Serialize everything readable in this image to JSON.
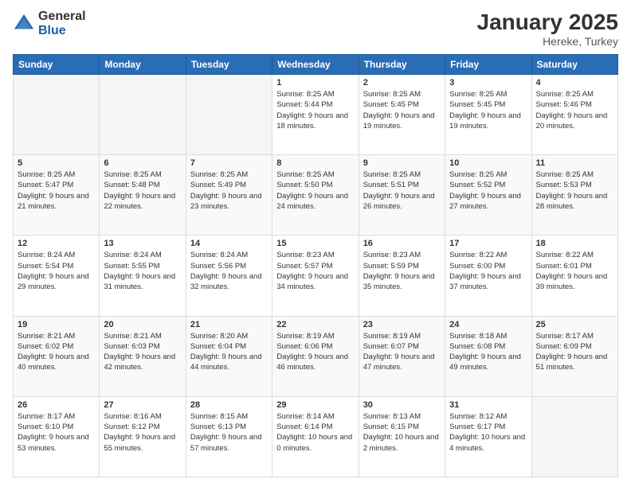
{
  "logo": {
    "general": "General",
    "blue": "Blue"
  },
  "header": {
    "month": "January 2025",
    "location": "Hereke, Turkey"
  },
  "weekdays": [
    "Sunday",
    "Monday",
    "Tuesday",
    "Wednesday",
    "Thursday",
    "Friday",
    "Saturday"
  ],
  "weeks": [
    [
      {
        "day": "",
        "sunrise": "",
        "sunset": "",
        "daylight": ""
      },
      {
        "day": "",
        "sunrise": "",
        "sunset": "",
        "daylight": ""
      },
      {
        "day": "",
        "sunrise": "",
        "sunset": "",
        "daylight": ""
      },
      {
        "day": "1",
        "sunrise": "Sunrise: 8:25 AM",
        "sunset": "Sunset: 5:44 PM",
        "daylight": "Daylight: 9 hours and 18 minutes."
      },
      {
        "day": "2",
        "sunrise": "Sunrise: 8:25 AM",
        "sunset": "Sunset: 5:45 PM",
        "daylight": "Daylight: 9 hours and 19 minutes."
      },
      {
        "day": "3",
        "sunrise": "Sunrise: 8:25 AM",
        "sunset": "Sunset: 5:45 PM",
        "daylight": "Daylight: 9 hours and 19 minutes."
      },
      {
        "day": "4",
        "sunrise": "Sunrise: 8:25 AM",
        "sunset": "Sunset: 5:46 PM",
        "daylight": "Daylight: 9 hours and 20 minutes."
      }
    ],
    [
      {
        "day": "5",
        "sunrise": "Sunrise: 8:25 AM",
        "sunset": "Sunset: 5:47 PM",
        "daylight": "Daylight: 9 hours and 21 minutes."
      },
      {
        "day": "6",
        "sunrise": "Sunrise: 8:25 AM",
        "sunset": "Sunset: 5:48 PM",
        "daylight": "Daylight: 9 hours and 22 minutes."
      },
      {
        "day": "7",
        "sunrise": "Sunrise: 8:25 AM",
        "sunset": "Sunset: 5:49 PM",
        "daylight": "Daylight: 9 hours and 23 minutes."
      },
      {
        "day": "8",
        "sunrise": "Sunrise: 8:25 AM",
        "sunset": "Sunset: 5:50 PM",
        "daylight": "Daylight: 9 hours and 24 minutes."
      },
      {
        "day": "9",
        "sunrise": "Sunrise: 8:25 AM",
        "sunset": "Sunset: 5:51 PM",
        "daylight": "Daylight: 9 hours and 26 minutes."
      },
      {
        "day": "10",
        "sunrise": "Sunrise: 8:25 AM",
        "sunset": "Sunset: 5:52 PM",
        "daylight": "Daylight: 9 hours and 27 minutes."
      },
      {
        "day": "11",
        "sunrise": "Sunrise: 8:25 AM",
        "sunset": "Sunset: 5:53 PM",
        "daylight": "Daylight: 9 hours and 28 minutes."
      }
    ],
    [
      {
        "day": "12",
        "sunrise": "Sunrise: 8:24 AM",
        "sunset": "Sunset: 5:54 PM",
        "daylight": "Daylight: 9 hours and 29 minutes."
      },
      {
        "day": "13",
        "sunrise": "Sunrise: 8:24 AM",
        "sunset": "Sunset: 5:55 PM",
        "daylight": "Daylight: 9 hours and 31 minutes."
      },
      {
        "day": "14",
        "sunrise": "Sunrise: 8:24 AM",
        "sunset": "Sunset: 5:56 PM",
        "daylight": "Daylight: 9 hours and 32 minutes."
      },
      {
        "day": "15",
        "sunrise": "Sunrise: 8:23 AM",
        "sunset": "Sunset: 5:57 PM",
        "daylight": "Daylight: 9 hours and 34 minutes."
      },
      {
        "day": "16",
        "sunrise": "Sunrise: 8:23 AM",
        "sunset": "Sunset: 5:59 PM",
        "daylight": "Daylight: 9 hours and 35 minutes."
      },
      {
        "day": "17",
        "sunrise": "Sunrise: 8:22 AM",
        "sunset": "Sunset: 6:00 PM",
        "daylight": "Daylight: 9 hours and 37 minutes."
      },
      {
        "day": "18",
        "sunrise": "Sunrise: 8:22 AM",
        "sunset": "Sunset: 6:01 PM",
        "daylight": "Daylight: 9 hours and 39 minutes."
      }
    ],
    [
      {
        "day": "19",
        "sunrise": "Sunrise: 8:21 AM",
        "sunset": "Sunset: 6:02 PM",
        "daylight": "Daylight: 9 hours and 40 minutes."
      },
      {
        "day": "20",
        "sunrise": "Sunrise: 8:21 AM",
        "sunset": "Sunset: 6:03 PM",
        "daylight": "Daylight: 9 hours and 42 minutes."
      },
      {
        "day": "21",
        "sunrise": "Sunrise: 8:20 AM",
        "sunset": "Sunset: 6:04 PM",
        "daylight": "Daylight: 9 hours and 44 minutes."
      },
      {
        "day": "22",
        "sunrise": "Sunrise: 8:19 AM",
        "sunset": "Sunset: 6:06 PM",
        "daylight": "Daylight: 9 hours and 46 minutes."
      },
      {
        "day": "23",
        "sunrise": "Sunrise: 8:19 AM",
        "sunset": "Sunset: 6:07 PM",
        "daylight": "Daylight: 9 hours and 47 minutes."
      },
      {
        "day": "24",
        "sunrise": "Sunrise: 8:18 AM",
        "sunset": "Sunset: 6:08 PM",
        "daylight": "Daylight: 9 hours and 49 minutes."
      },
      {
        "day": "25",
        "sunrise": "Sunrise: 8:17 AM",
        "sunset": "Sunset: 6:09 PM",
        "daylight": "Daylight: 9 hours and 51 minutes."
      }
    ],
    [
      {
        "day": "26",
        "sunrise": "Sunrise: 8:17 AM",
        "sunset": "Sunset: 6:10 PM",
        "daylight": "Daylight: 9 hours and 53 minutes."
      },
      {
        "day": "27",
        "sunrise": "Sunrise: 8:16 AM",
        "sunset": "Sunset: 6:12 PM",
        "daylight": "Daylight: 9 hours and 55 minutes."
      },
      {
        "day": "28",
        "sunrise": "Sunrise: 8:15 AM",
        "sunset": "Sunset: 6:13 PM",
        "daylight": "Daylight: 9 hours and 57 minutes."
      },
      {
        "day": "29",
        "sunrise": "Sunrise: 8:14 AM",
        "sunset": "Sunset: 6:14 PM",
        "daylight": "Daylight: 10 hours and 0 minutes."
      },
      {
        "day": "30",
        "sunrise": "Sunrise: 8:13 AM",
        "sunset": "Sunset: 6:15 PM",
        "daylight": "Daylight: 10 hours and 2 minutes."
      },
      {
        "day": "31",
        "sunrise": "Sunrise: 8:12 AM",
        "sunset": "Sunset: 6:17 PM",
        "daylight": "Daylight: 10 hours and 4 minutes."
      },
      {
        "day": "",
        "sunrise": "",
        "sunset": "",
        "daylight": ""
      }
    ]
  ]
}
